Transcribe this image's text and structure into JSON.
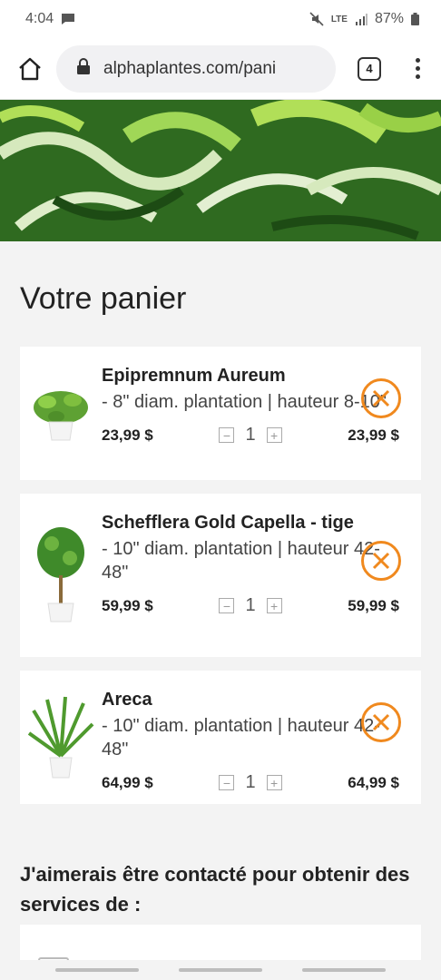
{
  "status": {
    "time": "4:04",
    "network": "LTE",
    "battery": "87%"
  },
  "browser": {
    "url": "alphaplantes.com/pani",
    "tab_count": "4"
  },
  "page": {
    "title": "Votre panier"
  },
  "cart": [
    {
      "name": "Epipremnum Aureum",
      "desc": " - 8\" diam. plantation | hauteur 8-10\"",
      "price": "23,99 $",
      "qty": "1",
      "total": "23,99 $"
    },
    {
      "name": "Schefflera Gold Capella - tige",
      "desc": " - 10\" diam. plantation | hauteur 42-48\"",
      "price": "59,99 $",
      "qty": "1",
      "total": "59,99 $"
    },
    {
      "name": "Areca",
      "desc": " - 10\" diam. plantation | hauteur 42-48\"",
      "price": "64,99 $",
      "qty": "1",
      "total": "64,99 $"
    }
  ],
  "contact": {
    "heading": "J'aimerais être contacté pour obtenir des services de :"
  },
  "icons": {
    "home": "home-icon",
    "lock": "lock-icon",
    "menu": "more-vert-icon",
    "remove": "remove-circle-x-icon",
    "minus": "minus-box-icon",
    "plus": "plus-box-icon"
  },
  "colors": {
    "accent": "#f0891e"
  }
}
